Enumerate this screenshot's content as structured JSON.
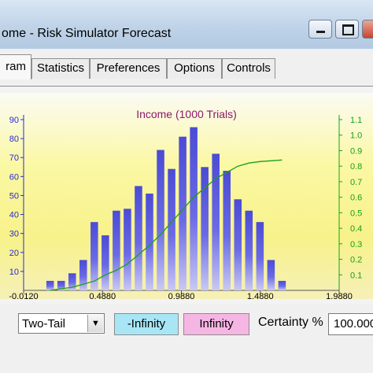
{
  "window": {
    "title": "ome - Risk Simulator Forecast"
  },
  "tabs": [
    {
      "label": "ram",
      "active": true
    },
    {
      "label": "Statistics",
      "active": false
    },
    {
      "label": "Preferences",
      "active": false
    },
    {
      "label": "Options",
      "active": false
    },
    {
      "label": "Controls",
      "active": false
    }
  ],
  "chart_data": {
    "type": "bar",
    "title": "Income (1000 Trials)",
    "title_color": "#8b1a6b",
    "bar_color": "#6a6ae6",
    "curve_color": "#1aa01a",
    "x_tick_labels": [
      "-0.0120",
      "0.4880",
      "0.9880",
      "1.4880",
      "1.9880"
    ],
    "x_ticks": [
      -0.012,
      0.488,
      0.988,
      1.488,
      1.988
    ],
    "xlim": [
      -0.012,
      1.988
    ],
    "y_left_ticks": [
      "10",
      "20",
      "30",
      "40",
      "50",
      "60",
      "70",
      "80",
      "90"
    ],
    "ylim_left": [
      0,
      90
    ],
    "y_right_ticks": [
      "0.1",
      "0.2",
      "0.3",
      "0.4",
      "0.5",
      "0.6",
      "0.7",
      "0.8",
      "0.9",
      "1.0",
      "1.1"
    ],
    "ylim_right": [
      0,
      1.1
    ],
    "bin_centers": [
      0.156,
      0.226,
      0.296,
      0.366,
      0.436,
      0.506,
      0.576,
      0.646,
      0.716,
      0.786,
      0.856,
      0.926,
      0.996,
      1.066,
      1.136,
      1.206,
      1.276,
      1.346,
      1.416,
      1.486,
      1.556,
      1.626
    ],
    "values": [
      5,
      5,
      9,
      16,
      36,
      29,
      42,
      43,
      55,
      51,
      74,
      64,
      81,
      86,
      65,
      72,
      63,
      48,
      42,
      36,
      16,
      5
    ],
    "cumulative": {
      "x": [
        0.156,
        0.226,
        0.296,
        0.366,
        0.436,
        0.506,
        0.576,
        0.646,
        0.716,
        0.786,
        0.856,
        0.926,
        0.996,
        1.066,
        1.136,
        1.206,
        1.276,
        1.346,
        1.416,
        1.486,
        1.556,
        1.626
      ],
      "y": [
        0.0,
        0.01,
        0.02,
        0.04,
        0.06,
        0.1,
        0.13,
        0.17,
        0.23,
        0.29,
        0.36,
        0.44,
        0.52,
        0.6,
        0.66,
        0.72,
        0.76,
        0.8,
        0.82,
        0.83,
        0.835,
        0.84
      ]
    }
  },
  "controls": {
    "tail_select": "Two-Tail",
    "lower_bound": "-Infinity",
    "upper_bound": "Infinity",
    "certainty_label": "Certainty %",
    "certainty_value": "100.000",
    "lower_bound_color": "#a8e6f6",
    "upper_bound_color": "#f6b6e4"
  }
}
